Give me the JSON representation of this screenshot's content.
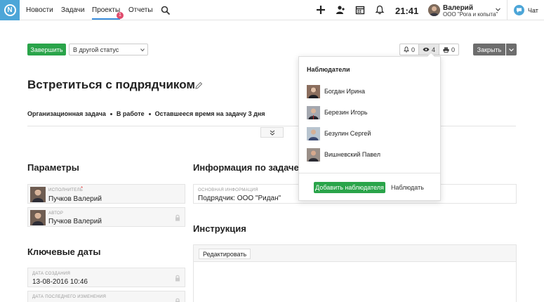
{
  "nav": {
    "items": [
      {
        "label": "Новости"
      },
      {
        "label": "Задачи"
      },
      {
        "label": "Проекты"
      },
      {
        "label": "Отчеты"
      }
    ],
    "projects_badge": "1",
    "clock": "21:41",
    "user_name": "Валерий",
    "user_org": "ООО \"Рога и копыта\"",
    "chat_label": "Чат"
  },
  "toolbar": {
    "complete_label": "Завершить",
    "status_value": "В другой статус",
    "counters": [
      {
        "icon": "bell-icon",
        "value": "0"
      },
      {
        "icon": "eye-icon",
        "value": "4"
      },
      {
        "icon": "printer-icon",
        "value": "0"
      }
    ],
    "close_label": "Закрыть"
  },
  "task": {
    "title": "Встретиться с подрядчиком",
    "type": "Организационная задача",
    "status": "В работе",
    "time_left": "Оставшееся время на задачу 3 дня"
  },
  "params": {
    "title": "Параметры",
    "executor_label": "ИСПОЛНИТЕЛЬ",
    "executor_value": "Пучков Валерий",
    "author_label": "АВТОР",
    "author_value": "Пучков Валерий",
    "required_mark": "*"
  },
  "dates": {
    "title": "Ключевые даты",
    "created_label": "ДАТА СОЗДАНИЯ",
    "created_value": "13-08-2016 10:46",
    "modified_label": "ДАТА ПОСЛЕДНЕГО ИЗМЕНЕНИЯ"
  },
  "info": {
    "title": "Информация по задаче",
    "main_label": "ОСНОВНАЯ ИНФОРМАЦИЯ",
    "main_value": "Подрядчик: ООО \"Ридан\""
  },
  "instruction": {
    "title": "Инструкция",
    "edit_label": "Редактировать"
  },
  "watchers": {
    "title": "Наблюдатели",
    "people": [
      {
        "name": "Богдан Ирина"
      },
      {
        "name": "Березин Игорь"
      },
      {
        "name": "Безулин Сергей"
      },
      {
        "name": "Вишневский Павел"
      }
    ],
    "add_label": "Добавить наблюдателя",
    "observe_label": "Наблюдать"
  },
  "colors": {
    "accent": "#3a8dde",
    "success": "#2aa44a",
    "logo": "#4da6d8",
    "badge": "#e04b6c"
  }
}
